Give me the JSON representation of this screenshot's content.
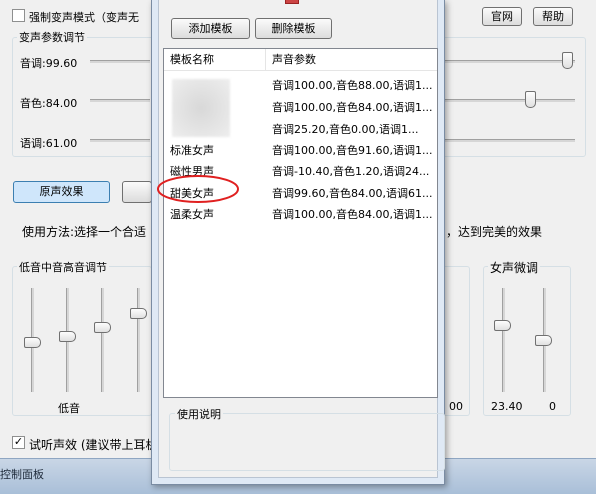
{
  "main": {
    "force_mode_label": "强制变声模式（变声无",
    "official_btn": "官网",
    "help_btn": "帮助",
    "params_group": "变声参数调节",
    "pitch_label": "音调:99.60",
    "timbre_label": "音色:84.00",
    "speed_label": "语调:61.00",
    "pitch_value": 0.996,
    "timbre_value": 0.84,
    "speed_value": 0.61,
    "original_btn": "原声效果",
    "usage_text_left": "使用方法:选择一个合适",
    "usage_text_right": "，达到完美的效果",
    "eq_group": "低音中音高音调节",
    "eq_bass_label": "低音",
    "right_value_stub": "00",
    "female_group": "女声微调",
    "female_val1": "23.40",
    "female_val2": "0",
    "preview_label": "试听声效 (建议带上耳机",
    "preview_checked": true,
    "force_checked": false,
    "bottom_bar": "控制面板"
  },
  "dialog": {
    "add_btn": "添加模板",
    "delete_btn": "删除模板",
    "col_name": "模板名称",
    "col_params": "声音参数",
    "rows": [
      {
        "name": "",
        "params": "音调100.00,音色88.00,语调1..."
      },
      {
        "name": "",
        "params": "音调100.00,音色84.00,语调1..."
      },
      {
        "name": "",
        "params": "音调25.20,音色0.00,语调1..."
      },
      {
        "name": "标准女声",
        "params": "音调100.00,音色91.60,语调1..."
      },
      {
        "name": "磁性男声",
        "params": "音调-10.40,音色1.20,语调24..."
      },
      {
        "name": "甜美女声",
        "params": "音调99.60,音色84.00,语调61..."
      },
      {
        "name": "温柔女声",
        "params": "音调100.00,音色84.00,语调1..."
      }
    ],
    "usage_group": "使用说明"
  },
  "colors": {
    "highlight_circle": "#e02020",
    "selected_button_bg": "#cfe6fb"
  }
}
